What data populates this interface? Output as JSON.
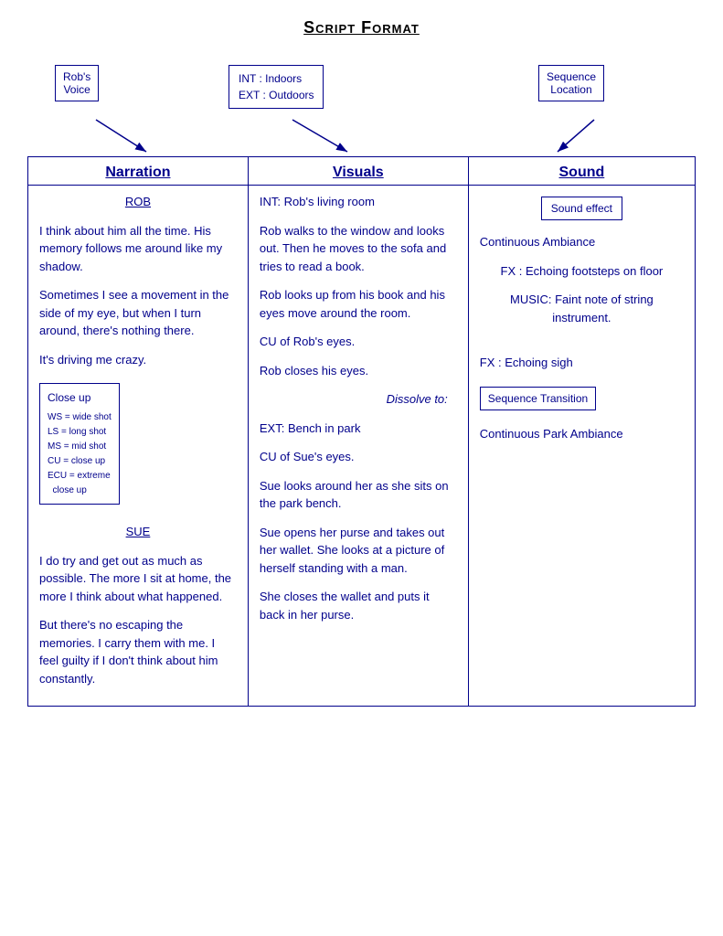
{
  "page": {
    "title": "Script Format",
    "annotations": {
      "rob_voice": "Rob's\nVoice",
      "int_ext": "INT : Indoors\nEXT : Outdoors",
      "seq_loc": "Sequence\nLocation"
    },
    "columns": {
      "narration": "Narration",
      "visuals": "Visuals",
      "sound": "Sound"
    },
    "narration_content": {
      "speaker1": "ROB",
      "p1": "I think about him all the time. His memory follows me around like my shadow.",
      "p2": "Sometimes I see a movement in the side of my eye, but when I turn around, there's nothing there.",
      "p3": "It's driving me crazy.",
      "closeup_label": "Close up",
      "closeup_legend": "WS = wide shot\nLS = long shot\nMS = mid shot\nCU = close up\nECU = extreme close up",
      "speaker2": "SUE",
      "p4": "I do try and get out as much as possible. The more I sit at home, the more I think about what happened.",
      "p5": "But there's no escaping the memories. I carry them with me. I feel guilty if I don't think about him constantly."
    },
    "visuals_content": {
      "v1": "INT: Rob's living room",
      "v2": "Rob walks to the window and looks out. Then he moves to the sofa and tries to read a book.",
      "v3": "Rob looks up from his book and his eyes move around the room.",
      "v4": "CU of Rob's eyes.",
      "v5": "Rob closes his eyes.",
      "v6": "Dissolve to:",
      "v7": "EXT: Bench in park",
      "v8": "CU of Sue's eyes.",
      "v9": "Sue looks around her as she sits on the park bench.",
      "v10": "Sue opens her purse and takes out her wallet. She looks at a picture of herself standing with a man.",
      "v11": "She closes the wallet and puts it back in her purse."
    },
    "sound_content": {
      "sound_effect_box": "Sound effect",
      "s1": "Continuous Ambiance",
      "s2": "FX : Echoing footsteps on floor",
      "s3": "MUSIC: Faint note of string instrument.",
      "s4": "FX : Echoing sigh",
      "seq_transition_box": "Sequence Transition",
      "s5": "Continuous Park Ambiance"
    }
  }
}
